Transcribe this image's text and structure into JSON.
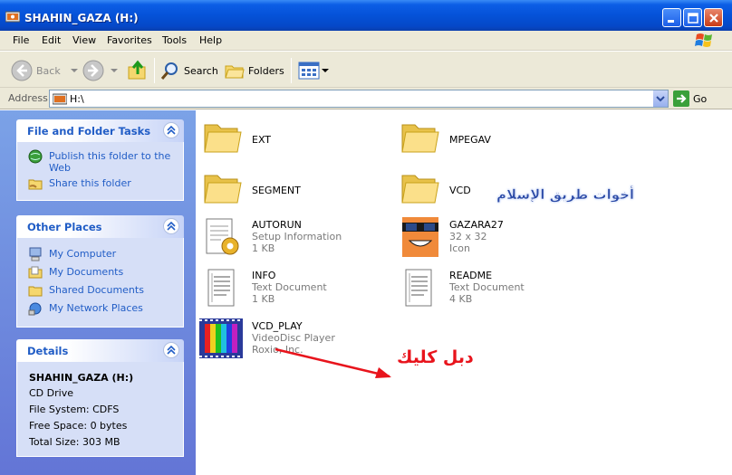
{
  "window": {
    "title": "SHAHIN_GAZA (H:)"
  },
  "menu": [
    "File",
    "Edit",
    "View",
    "Favorites",
    "Tools",
    "Help"
  ],
  "toolbar": {
    "back_label": "Back",
    "search_label": "Search",
    "folders_label": "Folders"
  },
  "address": {
    "label": "Address",
    "value": "H:\\",
    "go_label": "Go"
  },
  "panels": {
    "file_tasks": {
      "title": "File and Folder Tasks",
      "items": [
        "Publish this folder to the Web",
        "Share this folder"
      ]
    },
    "other_places": {
      "title": "Other Places",
      "items": [
        "My Computer",
        "My Documents",
        "Shared Documents",
        "My Network Places"
      ]
    },
    "details": {
      "title": "Details",
      "name": "SHAHIN_GAZA (H:)",
      "type": "CD Drive",
      "filesystem": "File System: CDFS",
      "free": "Free Space: 0 bytes",
      "total": "Total Size: 303 MB"
    }
  },
  "files": [
    {
      "name": "EXT",
      "kind": "folder"
    },
    {
      "name": "MPEGAV",
      "kind": "folder"
    },
    {
      "name": "SEGMENT",
      "kind": "folder"
    },
    {
      "name": "VCD",
      "kind": "folder"
    },
    {
      "name": "AUTORUN",
      "line2": "Setup Information",
      "line3": "1 KB",
      "kind": "setup"
    },
    {
      "name": "GAZARA27",
      "line2": "32 x 32",
      "line3": "Icon",
      "kind": "icon"
    },
    {
      "name": "INFO",
      "line2": "Text Document",
      "line3": "1 KB",
      "kind": "text"
    },
    {
      "name": "README",
      "line2": "Text Document",
      "line3": "4 KB",
      "kind": "text"
    },
    {
      "name": "VCD_PLAY",
      "line2": "VideoDisc Player",
      "line3": "Roxio, Inc.",
      "kind": "app"
    }
  ],
  "annotations": {
    "watermark": "أخوات طريق الإسلام",
    "double_click": "دبل كليك"
  },
  "colors": {
    "title_blue": "#0552d8",
    "task_link": "#215dc6",
    "arrow_red": "#e8141c"
  }
}
